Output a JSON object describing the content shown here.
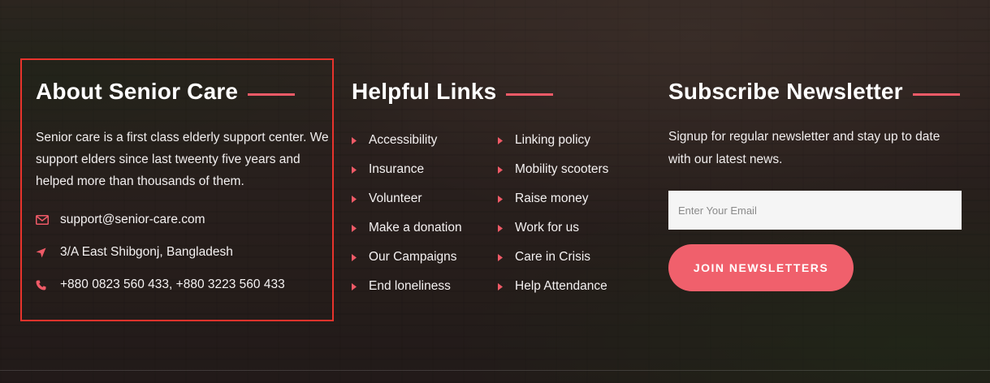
{
  "colors": {
    "accent": "#f0606c",
    "highlight_border": "#e8332c",
    "text": "#ffffff"
  },
  "about": {
    "title": "About Senior Care",
    "description": "Senior care is a first class elderly support center. We support elders since last tweenty five years and helped more than thousands of them.",
    "contacts": [
      {
        "icon": "envelope-icon",
        "text": "support@senior-care.com"
      },
      {
        "icon": "location-arrow-icon",
        "text": "3/A East Shibgonj, Bangladesh"
      },
      {
        "icon": "phone-icon",
        "text": "+880 0823 560 433, +880 3223 560 433"
      }
    ]
  },
  "links": {
    "title": "Helpful Links",
    "left": [
      "Accessibility",
      "Insurance",
      "Volunteer",
      "Make a donation",
      "Our Campaigns",
      "End loneliness"
    ],
    "right": [
      "Linking policy",
      "Mobility scooters",
      "Raise money",
      "Work for us",
      "Care in Crisis",
      "Help Attendance"
    ]
  },
  "newsletter": {
    "title": "Subscribe Newsletter",
    "description": "Signup for regular newsletter and stay up to date with our latest news.",
    "email_placeholder": "Enter Your Email",
    "button_label": "JOIN NEWSLETTERS"
  }
}
